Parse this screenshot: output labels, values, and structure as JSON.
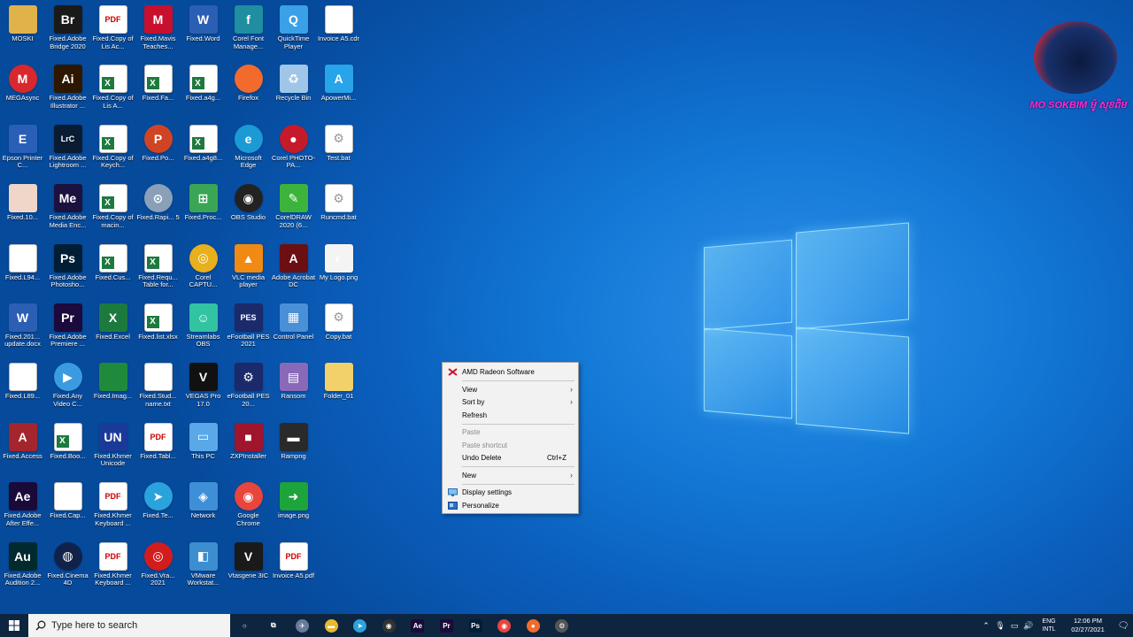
{
  "desktop": {
    "icons": [
      {
        "label": "MOSKI",
        "icon": "user-folder-icon",
        "glyph": "",
        "bg": "#e0b24a"
      },
      {
        "label": "Fixed.Adobe Bridge 2020",
        "icon": "adobe-bridge-icon",
        "glyph": "Br",
        "bg": "#1a1a1a"
      },
      {
        "label": "Fixed.Copy of Lis Ac...",
        "icon": "pdf-file-icon",
        "glyph": "PDF",
        "bg": "paper"
      },
      {
        "label": "Fixed.Mavis Teaches...",
        "icon": "mavis-beacon-icon",
        "glyph": "M",
        "bg": "#c8102e"
      },
      {
        "label": "Fixed.Word",
        "icon": "word-icon",
        "glyph": "W",
        "bg": "#2b5fb4"
      },
      {
        "label": "Corel Font Manage...",
        "icon": "corel-font-manager-icon",
        "glyph": "f",
        "bg": "#1f8ea0"
      },
      {
        "label": "QuickTime Player",
        "icon": "quicktime-icon",
        "glyph": "Q",
        "bg": "#3aa0e8"
      },
      {
        "label": "Invoice A5.cdr",
        "icon": "cdr-file-icon",
        "glyph": "",
        "bg": "sheetplain"
      },
      {
        "label": "MEGAsync",
        "icon": "mega-icon",
        "glyph": "M",
        "bg": "#d9272e",
        "round": true
      },
      {
        "label": "Fixed.Adobe Illustrator ...",
        "icon": "adobe-illustrator-icon",
        "glyph": "Ai",
        "bg": "#2e1700"
      },
      {
        "label": "Fixed.Copy of Lis A...",
        "icon": "excel-file-icon",
        "glyph": "",
        "bg": "sheet"
      },
      {
        "label": "Fixed.Fa...",
        "icon": "excel-file-icon",
        "glyph": "",
        "bg": "sheet"
      },
      {
        "label": "Fixed.a4g...",
        "icon": "excel-file-icon",
        "glyph": "",
        "bg": "sheet"
      },
      {
        "label": "Firefox",
        "icon": "firefox-icon",
        "glyph": "",
        "bg": "#f36b2c",
        "round": true
      },
      {
        "label": "Recycle Bin",
        "icon": "recycle-bin-icon",
        "glyph": "♻",
        "bg": "#9fc6e8"
      },
      {
        "label": "ApowerMi...",
        "icon": "apowermirror-icon",
        "glyph": "A",
        "bg": "#27a4ea"
      },
      {
        "label": "Epson Printer C...",
        "icon": "epson-printer-icon",
        "glyph": "E",
        "bg": "#2a5fb8"
      },
      {
        "label": "Fixed.Adobe Lightroom ...",
        "icon": "adobe-lightroom-icon",
        "glyph": "LrC",
        "bg": "#0a1c33"
      },
      {
        "label": "Fixed.Copy of Keych...",
        "icon": "excel-file-icon",
        "glyph": "",
        "bg": "sheet"
      },
      {
        "label": "Fixed.Po...",
        "icon": "powerpoint-icon",
        "glyph": "P",
        "bg": "#d04423",
        "round": true
      },
      {
        "label": "Fixed.a4g8...",
        "icon": "excel-file-icon",
        "glyph": "",
        "bg": "sheet"
      },
      {
        "label": "Microsoft Edge",
        "icon": "edge-icon",
        "glyph": "e",
        "bg": "#1b9ad6",
        "round": true
      },
      {
        "label": "Corel PHOTO-PA...",
        "icon": "corel-photopaint-icon",
        "glyph": "●",
        "bg": "#c41a2a",
        "round": true
      },
      {
        "label": "Test.bat",
        "icon": "bat-file-icon",
        "glyph": "⚙",
        "bg": "sheetplain"
      },
      {
        "label": "Fixed.10...",
        "icon": "image-file-icon",
        "glyph": "",
        "bg": "#f0d6c8"
      },
      {
        "label": "Fixed.Adobe Media Enc...",
        "icon": "adobe-media-encoder-icon",
        "glyph": "Me",
        "bg": "#1b1240"
      },
      {
        "label": "Fixed.Copy of macin...",
        "icon": "excel-file-icon",
        "glyph": "",
        "bg": "sheet"
      },
      {
        "label": "Fixed.Rapi... 5",
        "icon": "rapid-typing-icon",
        "glyph": "⊙",
        "bg": "#8aa0b8",
        "round": true
      },
      {
        "label": "Fixed.Proc...",
        "icon": "windows-program-icon",
        "glyph": "⊞",
        "bg": "#3aa655"
      },
      {
        "label": "OBS Studio",
        "icon": "obs-icon",
        "glyph": "◉",
        "bg": "#222",
        "round": true
      },
      {
        "label": "CorelDRAW 2020 (6...",
        "icon": "coreldraw-icon",
        "glyph": "✎",
        "bg": "#3cb43c"
      },
      {
        "label": "Runcmd.bat",
        "icon": "bat-file-icon",
        "glyph": "⚙",
        "bg": "sheetplain"
      },
      {
        "label": "Fixed.L94...",
        "icon": "image-file-icon",
        "glyph": "",
        "bg": "sheetplain"
      },
      {
        "label": "Fixed.Adobe Photosho...",
        "icon": "adobe-photoshop-icon",
        "glyph": "Ps",
        "bg": "#001e36"
      },
      {
        "label": "Fixed.Cus...",
        "icon": "excel-file-icon",
        "glyph": "",
        "bg": "sheet"
      },
      {
        "label": "Fixed.Requ... Table for...",
        "icon": "excel-file-icon",
        "glyph": "",
        "bg": "sheet"
      },
      {
        "label": "Corel CAPTU...",
        "icon": "corel-capture-icon",
        "glyph": "◎",
        "bg": "#e8b01c",
        "round": true
      },
      {
        "label": "VLC media player",
        "icon": "vlc-icon",
        "glyph": "▲",
        "bg": "#f08a12"
      },
      {
        "label": "Adobe Acrobat DC",
        "icon": "adobe-acrobat-icon",
        "glyph": "A",
        "bg": "#6b0f12"
      },
      {
        "label": "My Logo.png",
        "icon": "png-file-icon",
        "glyph": "◐",
        "bg": "#f4f4f4"
      },
      {
        "label": "Fixed.201... update.docx",
        "icon": "word-file-icon",
        "glyph": "W",
        "bg": "#2b5fb4"
      },
      {
        "label": "Fixed.Adobe Premiere ...",
        "icon": "adobe-premiere-icon",
        "glyph": "Pr",
        "bg": "#1c0a3c"
      },
      {
        "label": "Fixed.Excel",
        "icon": "excel-icon",
        "glyph": "X",
        "bg": "#1d7a3e"
      },
      {
        "label": "Fixed.list.xlsx",
        "icon": "excel-file-icon",
        "glyph": "",
        "bg": "sheet"
      },
      {
        "label": "Streamlabs OBS",
        "icon": "streamlabs-icon",
        "glyph": "☺",
        "bg": "#31c3a2"
      },
      {
        "label": "eFootball PES 2021",
        "icon": "pes-2021-icon",
        "glyph": "PES",
        "bg": "#1a2a6a"
      },
      {
        "label": "Control Panel",
        "icon": "control-panel-icon",
        "glyph": "▦",
        "bg": "#4a90d9"
      },
      {
        "label": "Copy.bat",
        "icon": "bat-file-icon",
        "glyph": "⚙",
        "bg": "sheetplain"
      },
      {
        "label": "Fixed.L89...",
        "icon": "image-file-icon",
        "glyph": "",
        "bg": "sheetplain"
      },
      {
        "label": "Fixed.Any Video C...",
        "icon": "any-video-converter-icon",
        "glyph": "▶",
        "bg": "#3a9be0",
        "round": true
      },
      {
        "label": "Fixed.Imag...",
        "icon": "image-file-icon",
        "glyph": "",
        "bg": "#1f8a3c"
      },
      {
        "label": "Fixed.Stud... name.txt",
        "icon": "txt-file-icon",
        "glyph": "",
        "bg": "sheetplain"
      },
      {
        "label": "VEGAS Pro 17.0",
        "icon": "vegas-pro-icon",
        "glyph": "V",
        "bg": "#111"
      },
      {
        "label": "eFootball PES 20...",
        "icon": "pes-20-icon",
        "glyph": "⚙",
        "bg": "#1a2a6a"
      },
      {
        "label": "Ransom",
        "icon": "winrar-icon",
        "glyph": "▤",
        "bg": "#8a6ab8"
      },
      {
        "label": "Folder_01",
        "icon": "folder-icon",
        "glyph": "",
        "bg": "#f2d06a"
      },
      {
        "label": "Fixed.Access",
        "icon": "access-icon",
        "glyph": "A",
        "bg": "#a4262c"
      },
      {
        "label": "Fixed.Boo...",
        "icon": "excel-file-icon",
        "glyph": "",
        "bg": "sheet"
      },
      {
        "label": "Fixed.Khmer Unicode Converter",
        "icon": "khmer-converter-icon",
        "glyph": "UN",
        "bg": "#1a3a9a"
      },
      {
        "label": "Fixed.Tabl...",
        "icon": "pdf-file-icon",
        "glyph": "PDF",
        "bg": "paper"
      },
      {
        "label": "This PC",
        "icon": "this-pc-icon",
        "glyph": "▭",
        "bg": "#5aa8e8"
      },
      {
        "label": "ZXPInstaller",
        "icon": "zxp-installer-icon",
        "glyph": "■",
        "bg": "#a0142c"
      },
      {
        "label": "Rampng",
        "icon": "ram-icon",
        "glyph": "▬",
        "bg": "#2a2a2a"
      },
      {
        "label": "",
        "icon": "",
        "glyph": "",
        "bg": "none"
      },
      {
        "label": "Fixed.Adobe After Effe...",
        "icon": "adobe-after-effects-icon",
        "glyph": "Ae",
        "bg": "#1a0a3a"
      },
      {
        "label": "Fixed.Cap...",
        "icon": "image-file-icon",
        "glyph": "",
        "bg": "sheetplain"
      },
      {
        "label": "Fixed.Khmer Keyboard ...",
        "icon": "pdf-file-icon",
        "glyph": "PDF",
        "bg": "paper"
      },
      {
        "label": "Fixed.Te...",
        "icon": "telegram-icon",
        "glyph": "➤",
        "bg": "#2aa3dc",
        "round": true
      },
      {
        "label": "Network",
        "icon": "network-icon",
        "glyph": "◈",
        "bg": "#3e8fd8"
      },
      {
        "label": "Google Chrome",
        "icon": "chrome-icon",
        "glyph": "◉",
        "bg": "#e8453c",
        "round": true
      },
      {
        "label": "image.png",
        "icon": "png-file-icon",
        "glyph": "➜",
        "bg": "#1da43a"
      },
      {
        "label": "",
        "icon": "",
        "glyph": "",
        "bg": "none"
      },
      {
        "label": "Fixed.Adobe Audition 2...",
        "icon": "adobe-audition-icon",
        "glyph": "Au",
        "bg": "#002a2e"
      },
      {
        "label": "Fixed.Cinema 4D",
        "icon": "cinema-4d-icon",
        "glyph": "◍",
        "bg": "#11224a",
        "round": true
      },
      {
        "label": "Fixed.Khmer Keyboard ...",
        "icon": "pdf-file-icon",
        "glyph": "PDF",
        "bg": "paper"
      },
      {
        "label": "Fixed.Vra... 2021",
        "icon": "vray-icon",
        "glyph": "◎",
        "bg": "#d31c1c",
        "round": true
      },
      {
        "label": "VMware Workstat...",
        "icon": "vmware-icon",
        "glyph": "◧",
        "bg": "#3b8ed0"
      },
      {
        "label": "Vtasgene 3IC",
        "icon": "vtasgene-icon",
        "glyph": "V",
        "bg": "#1a1a1a"
      },
      {
        "label": "Invoice A5.pdf",
        "icon": "pdf-file-icon",
        "glyph": "PDF",
        "bg": "paper"
      },
      {
        "label": "",
        "icon": "",
        "glyph": "",
        "bg": "none"
      }
    ]
  },
  "brand": {
    "text": "MO SOKBIM ម៉ូ សុខពិម"
  },
  "context_menu": {
    "amd": "AMD Radeon Software",
    "view": "View",
    "sort_by": "Sort by",
    "refresh": "Refresh",
    "paste": "Paste",
    "paste_shortcut": "Paste shortcut",
    "undo_delete": "Undo Delete",
    "undo_shortcut": "Ctrl+Z",
    "new": "New",
    "display_settings": "Display settings",
    "personalize": "Personalize"
  },
  "taskbar": {
    "search_placeholder": "Type here to search",
    "apps": [
      {
        "name": "cortana",
        "glyph": "○",
        "bg": "transparent"
      },
      {
        "name": "task-view",
        "glyph": "⧉",
        "bg": "transparent"
      },
      {
        "name": "vpn",
        "glyph": "✈",
        "bg": "#6a7a9a"
      },
      {
        "name": "file-explorer",
        "glyph": "▬",
        "bg": "#e8b830"
      },
      {
        "name": "telegram",
        "glyph": "➤",
        "bg": "#2aa3dc"
      },
      {
        "name": "obs",
        "glyph": "◉",
        "bg": "#333"
      },
      {
        "name": "after-effects",
        "glyph": "Ae",
        "bg": "#1a0a3a"
      },
      {
        "name": "premiere",
        "glyph": "Pr",
        "bg": "#1c0a3c"
      },
      {
        "name": "photoshop",
        "glyph": "Ps",
        "bg": "#001e36"
      },
      {
        "name": "chrome",
        "glyph": "◉",
        "bg": "#e8453c"
      },
      {
        "name": "firefox",
        "glyph": "●",
        "bg": "#f36b2c"
      },
      {
        "name": "settings",
        "glyph": "⚙",
        "bg": "#555"
      }
    ],
    "lang_top": "ENG",
    "lang_bottom": "INTL",
    "time": "12:06 PM",
    "date": "02/27/2021"
  }
}
